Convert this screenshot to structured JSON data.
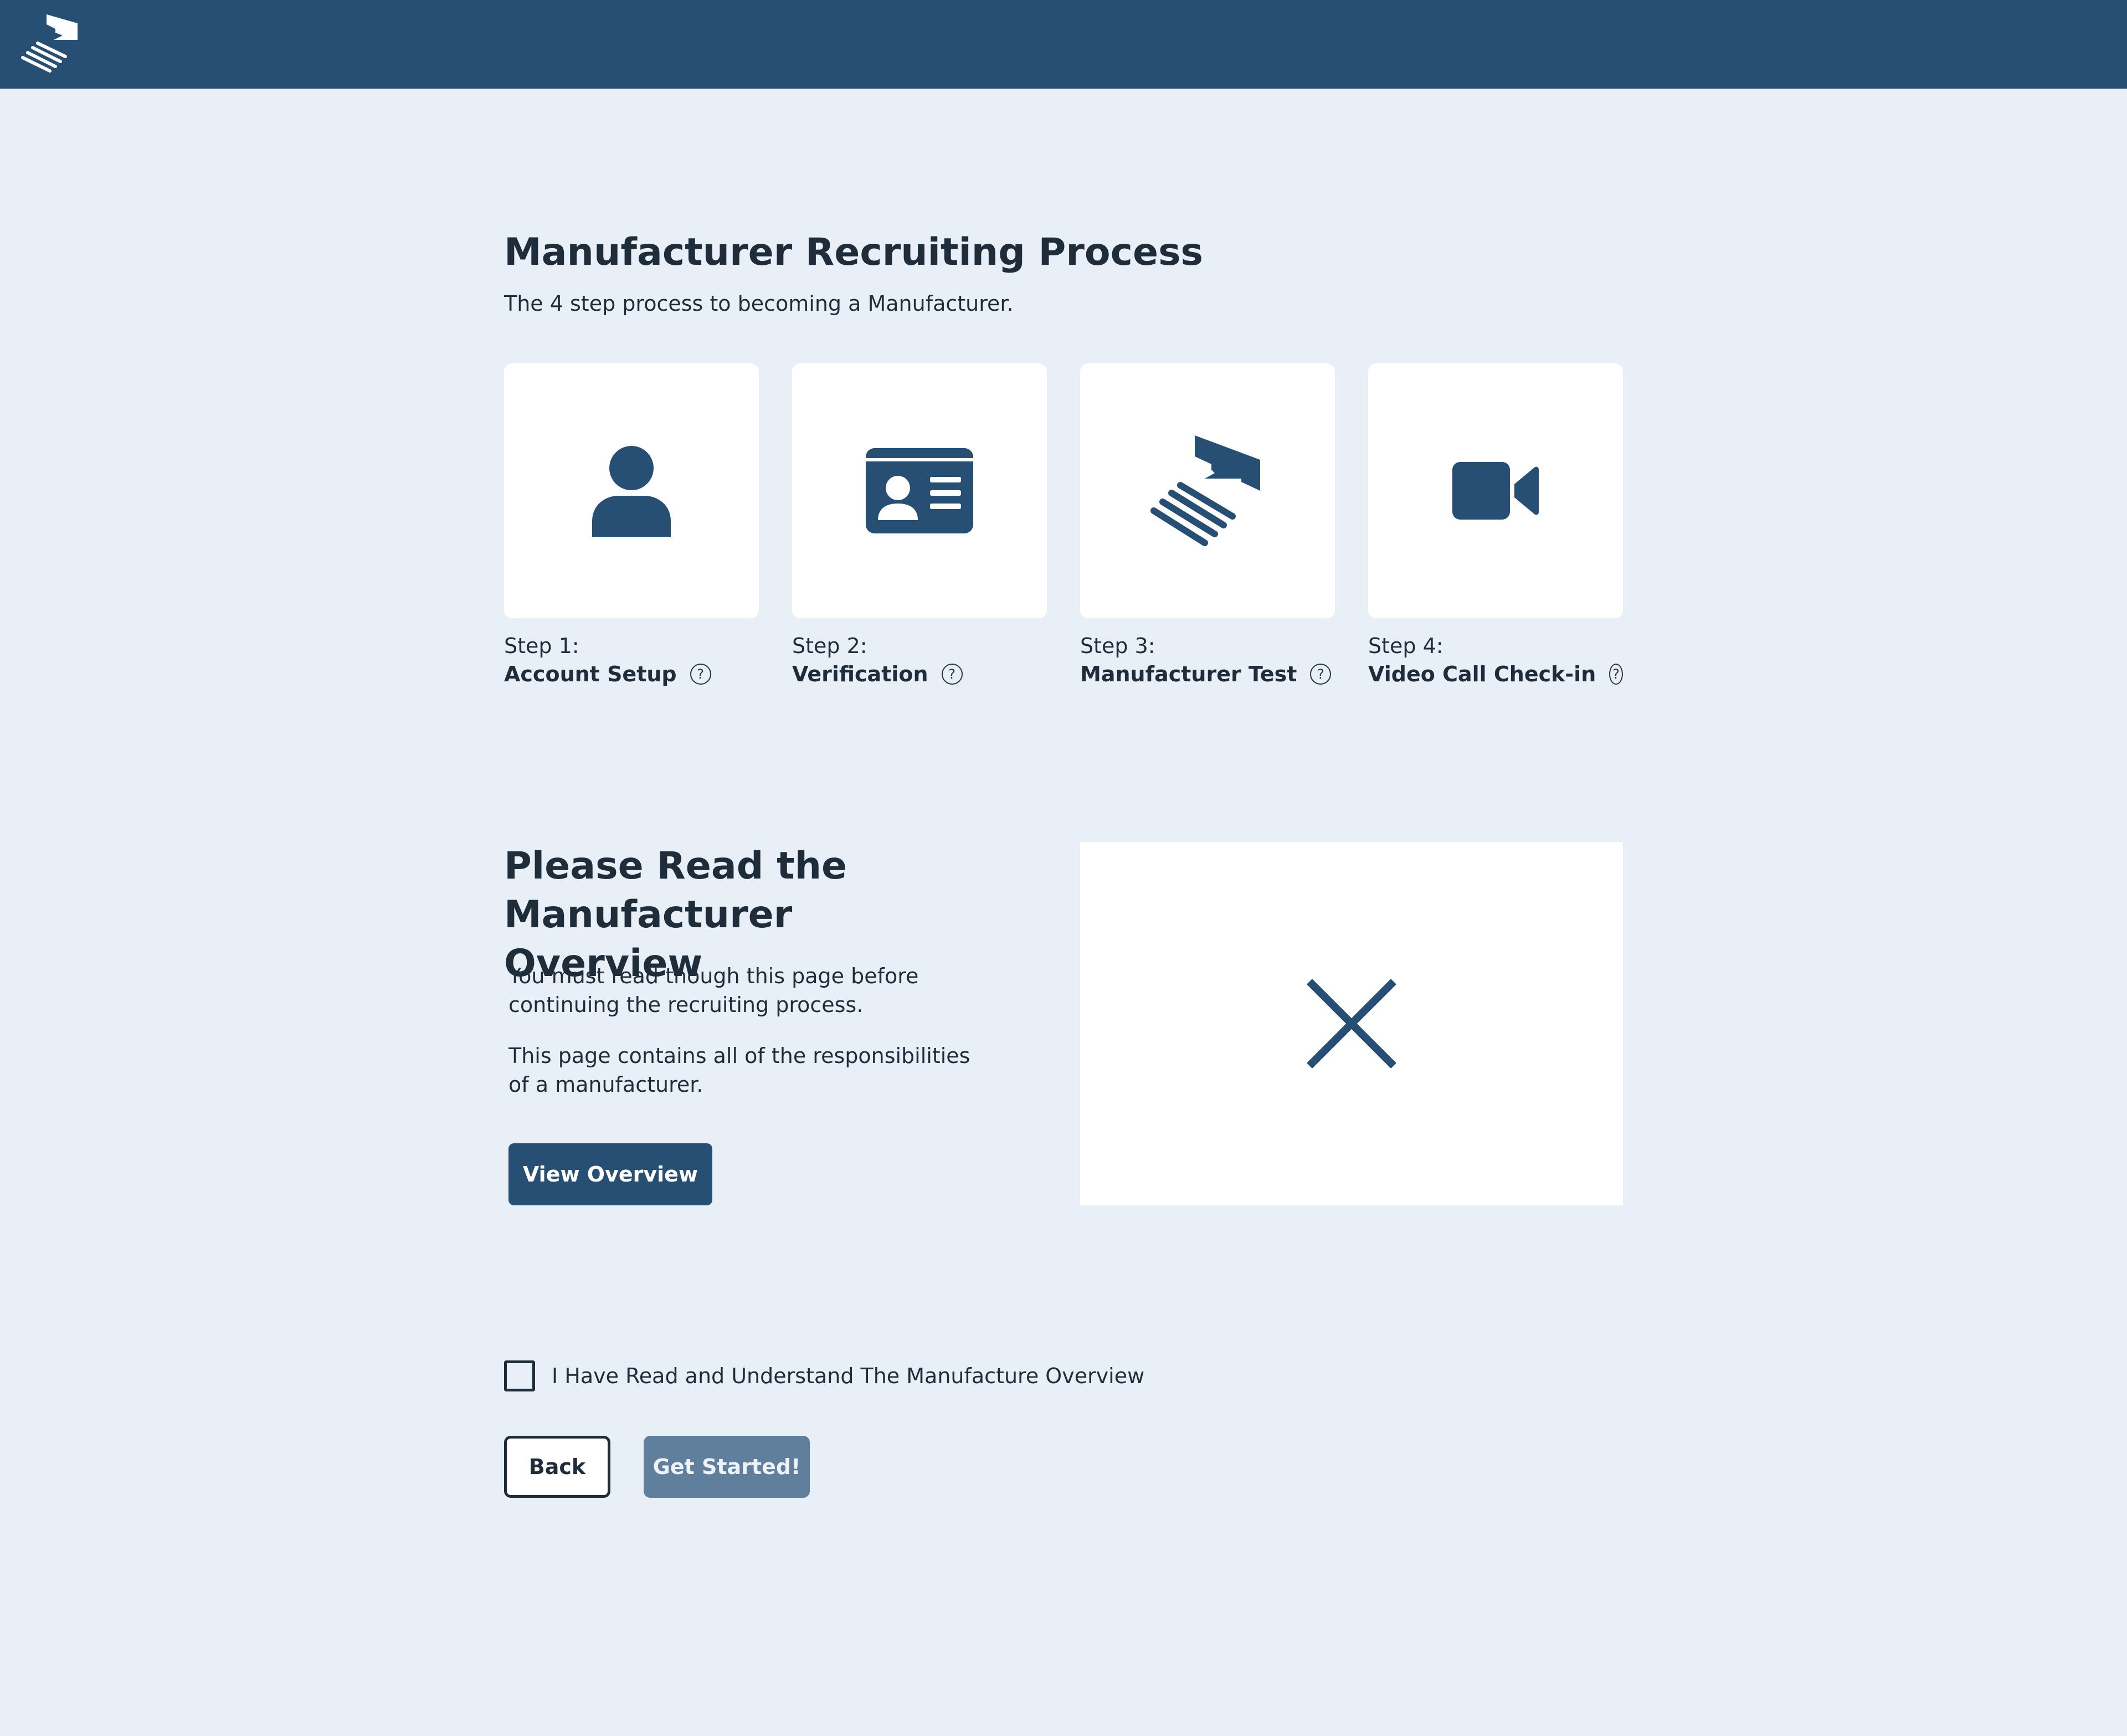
{
  "header": {
    "logo_icon": "manufacturer-logo-icon",
    "background_color": "#274f74"
  },
  "main": {
    "title": "Manufacturer Recruiting Process",
    "subtitle": "The 4 step process to becoming a Manufacturer.",
    "steps": [
      {
        "number_label": "Step 1:",
        "name": "Account Setup",
        "icon": "person-icon",
        "help": "?"
      },
      {
        "number_label": "Step 2:",
        "name": "Verification",
        "icon": "id-card-icon",
        "help": "?"
      },
      {
        "number_label": "Step 3:",
        "name": "Manufacturer Test",
        "icon": "manufacturer-logo-icon",
        "help": "?"
      },
      {
        "number_label": "Step 4:",
        "name": "Video Call Check-in",
        "icon": "video-camera-icon",
        "help": "?"
      }
    ]
  },
  "overview": {
    "heading_line1": "Please Read the",
    "heading_line2": "Manufacturer Overview",
    "paragraph1": "You must read though this page before continuing the recruiting process.",
    "paragraph2": "This page contains all of the responsibilities of a manufacturer.",
    "button_label": "View Overview",
    "preview_icon": "close-icon"
  },
  "agreement": {
    "checkbox_label": "I Have Read and Understand The Manufacture Overview",
    "checked": false
  },
  "actions": {
    "back_label": "Back",
    "start_label": "Get Started!"
  },
  "colors": {
    "page_background": "#e8eff7",
    "accent": "#274f74",
    "disabled_button": "#5f7f9c",
    "text": "#1f2d3b"
  }
}
